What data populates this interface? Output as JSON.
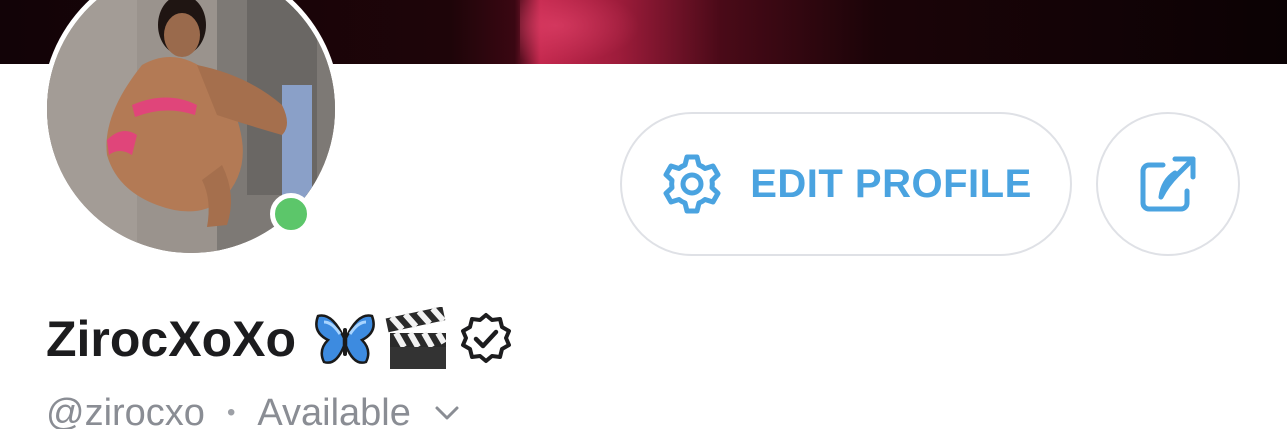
{
  "profile": {
    "display_name": "ZirocXoXo",
    "handle": "@zirocxo",
    "separator": "•",
    "status": "Available",
    "online": true
  },
  "actions": {
    "edit_label": "EDIT PROFILE"
  },
  "icons": {
    "edit": "gear-icon",
    "share": "share-icon",
    "name_badges": [
      "butterfly-icon",
      "clapper-board-icon",
      "verified-badge-icon"
    ],
    "status_menu": "chevron-down-icon"
  },
  "colors": {
    "accent": "#4aa3e0",
    "online": "#5cc66a",
    "muted_text": "#8a8d94",
    "name_text": "#1c1c1e",
    "border": "#dfe1e6"
  }
}
